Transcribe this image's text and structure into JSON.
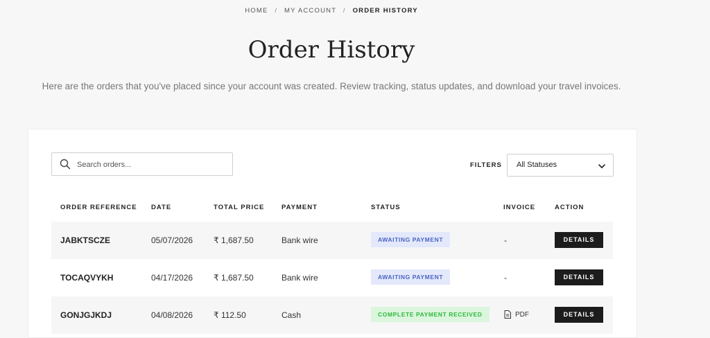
{
  "breadcrumb": {
    "items": [
      "HOME",
      "MY ACCOUNT"
    ],
    "current": "ORDER HISTORY",
    "separator": "/"
  },
  "page": {
    "title": "Order History",
    "subtitle": "Here are the orders that you've placed since your account was created. Review tracking, status updates, and download your travel invoices."
  },
  "search": {
    "placeholder": "Search orders...",
    "icon": "search-icon"
  },
  "filters": {
    "label": "FILTERS",
    "selected": "All Statuses",
    "icon": "chevron-down-icon"
  },
  "table": {
    "headers": [
      "ORDER REFERENCE",
      "DATE",
      "TOTAL PRICE",
      "PAYMENT",
      "STATUS",
      "INVOICE",
      "ACTION"
    ],
    "rows": [
      {
        "reference": "JABKTSCZE",
        "date": "05/07/2026",
        "total": "₹ 1,687.50",
        "payment": "Bank wire",
        "status": "AWAITING PAYMENT",
        "invoice": "-",
        "action": "DETAILS"
      },
      {
        "reference": "TOCAQVYKH",
        "date": "04/17/2026",
        "total": "₹ 1,687.50",
        "payment": "Bank wire",
        "status": "AWAITING PAYMENT",
        "invoice": "-",
        "action": "DETAILS"
      },
      {
        "reference": "GONJGJKDJ",
        "date": "04/08/2026",
        "total": "₹ 112.50",
        "payment": "Cash",
        "status": "COMPLETE PAYMENT RECEIVED",
        "invoice": "PDF",
        "action": "DETAILS"
      }
    ]
  },
  "colors": {
    "awaiting_bg": "#e3e9fb",
    "awaiting_text": "#4b63c2",
    "complete_bg": "#dbf6dd",
    "complete_text": "#2fb83e",
    "button_bg": "#1c1c1c"
  }
}
